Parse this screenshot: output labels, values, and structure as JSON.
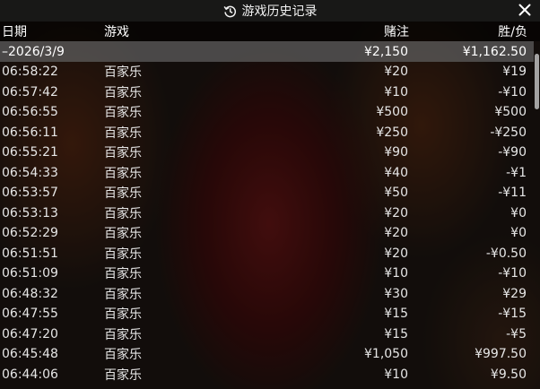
{
  "window": {
    "title": "游戏历史记录",
    "history_icon": "history-icon",
    "close_icon": "close-icon"
  },
  "columns": {
    "date": "日期",
    "game": "游戏",
    "bet": "赌注",
    "win_loss": "胜/负"
  },
  "summary": {
    "date": "–2026/3/9",
    "bet": "¥2,150",
    "win_loss": "¥1,162.50"
  },
  "rows": [
    {
      "time": "06:58:22",
      "game": "百家乐",
      "bet": "¥20",
      "win_loss": "¥19"
    },
    {
      "time": "06:57:42",
      "game": "百家乐",
      "bet": "¥10",
      "win_loss": "-¥10"
    },
    {
      "time": "06:56:55",
      "game": "百家乐",
      "bet": "¥500",
      "win_loss": "¥500"
    },
    {
      "time": "06:56:11",
      "game": "百家乐",
      "bet": "¥250",
      "win_loss": "-¥250"
    },
    {
      "time": "06:55:21",
      "game": "百家乐",
      "bet": "¥90",
      "win_loss": "-¥90"
    },
    {
      "time": "06:54:33",
      "game": "百家乐",
      "bet": "¥40",
      "win_loss": "-¥1"
    },
    {
      "time": "06:53:57",
      "game": "百家乐",
      "bet": "¥50",
      "win_loss": "-¥11"
    },
    {
      "time": "06:53:13",
      "game": "百家乐",
      "bet": "¥20",
      "win_loss": "¥0"
    },
    {
      "time": "06:52:29",
      "game": "百家乐",
      "bet": "¥20",
      "win_loss": "¥0"
    },
    {
      "time": "06:51:51",
      "game": "百家乐",
      "bet": "¥20",
      "win_loss": "-¥0.50"
    },
    {
      "time": "06:51:09",
      "game": "百家乐",
      "bet": "¥10",
      "win_loss": "-¥10"
    },
    {
      "time": "06:48:32",
      "game": "百家乐",
      "bet": "¥30",
      "win_loss": "¥29"
    },
    {
      "time": "06:47:55",
      "game": "百家乐",
      "bet": "¥15",
      "win_loss": "-¥15"
    },
    {
      "time": "06:47:20",
      "game": "百家乐",
      "bet": "¥15",
      "win_loss": "-¥5"
    },
    {
      "time": "06:45:48",
      "game": "百家乐",
      "bet": "¥1,050",
      "win_loss": "¥997.50"
    },
    {
      "time": "06:44:06",
      "game": "百家乐",
      "bet": "¥10",
      "win_loss": "¥9.50"
    }
  ]
}
